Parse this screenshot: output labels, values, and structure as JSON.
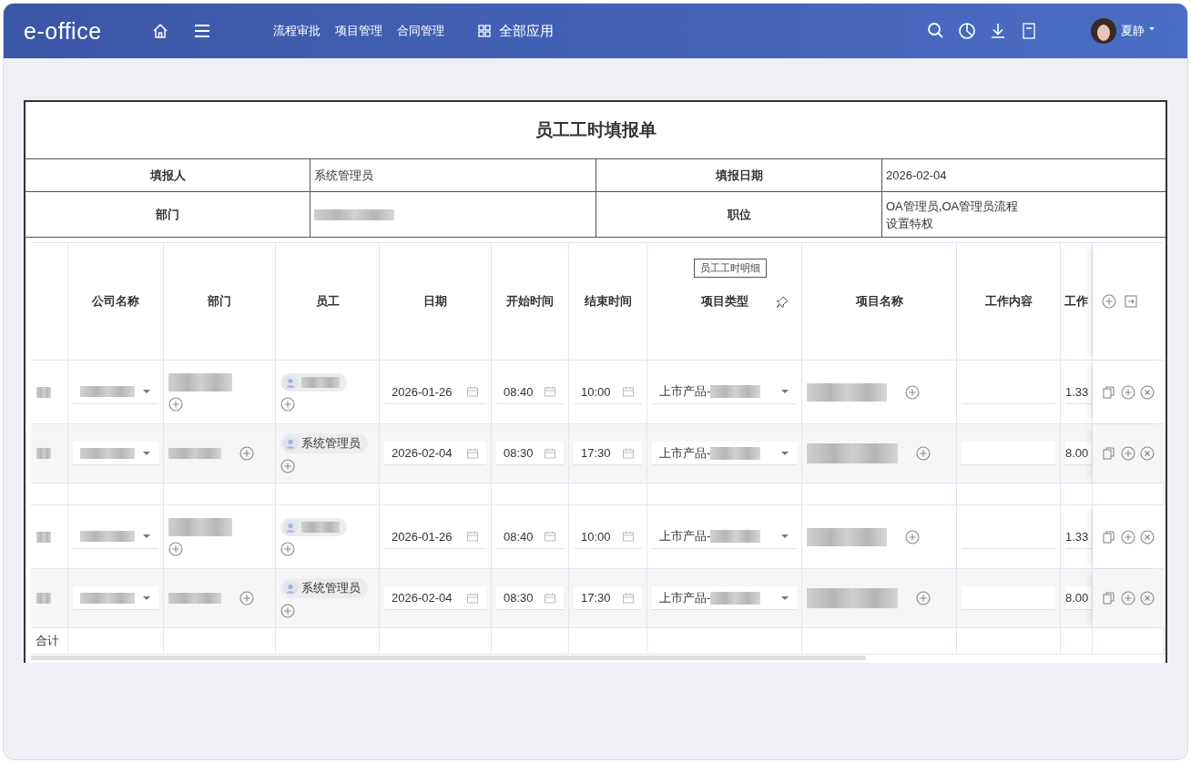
{
  "topbar": {
    "logo": "e-office",
    "nav": [
      {
        "label": "流程审批"
      },
      {
        "label": "项目管理"
      },
      {
        "label": "合同管理"
      }
    ],
    "apps": "全部应用",
    "user": "夏静"
  },
  "form": {
    "title": "员工工时填报单",
    "fields": [
      {
        "label": "填报人",
        "kind": "text",
        "value": "系统管理员"
      },
      {
        "label": "填报日期",
        "kind": "text",
        "value": "2026-02-04"
      },
      {
        "label": "部门",
        "kind": "blurred"
      },
      {
        "label": "职位",
        "kind": "text",
        "value": "OA管理员,OA管理员流程设置特权"
      }
    ]
  },
  "detail": {
    "tooltip": "员工工时明细",
    "columns": [
      "公司名称",
      "部门",
      "员工",
      "日期",
      "开始时间",
      "结束时间",
      "项目类型",
      "项目名称",
      "工作内容",
      "工作"
    ],
    "groups": [
      {
        "rows": [
          {
            "kind": "existing",
            "date": "2026-01-26",
            "start": "08:40",
            "end": "10:00",
            "project_type": "上市产品-",
            "hours": "1.33"
          },
          {
            "kind": "added",
            "employee": "系统管理员",
            "date": "2026-02-04",
            "start": "08:30",
            "end": "17:30",
            "project_type": "上市产品-",
            "hours": "8.00"
          }
        ]
      },
      {
        "rows": [
          {
            "kind": "existing",
            "date": "2026-01-26",
            "start": "08:40",
            "end": "10:00",
            "project_type": "上市产品-",
            "hours": "1.33"
          },
          {
            "kind": "added",
            "employee": "系统管理员",
            "date": "2026-02-04",
            "start": "08:30",
            "end": "17:30",
            "project_type": "上市产品-",
            "hours": "8.00"
          }
        ]
      }
    ],
    "total_label": "合计"
  }
}
